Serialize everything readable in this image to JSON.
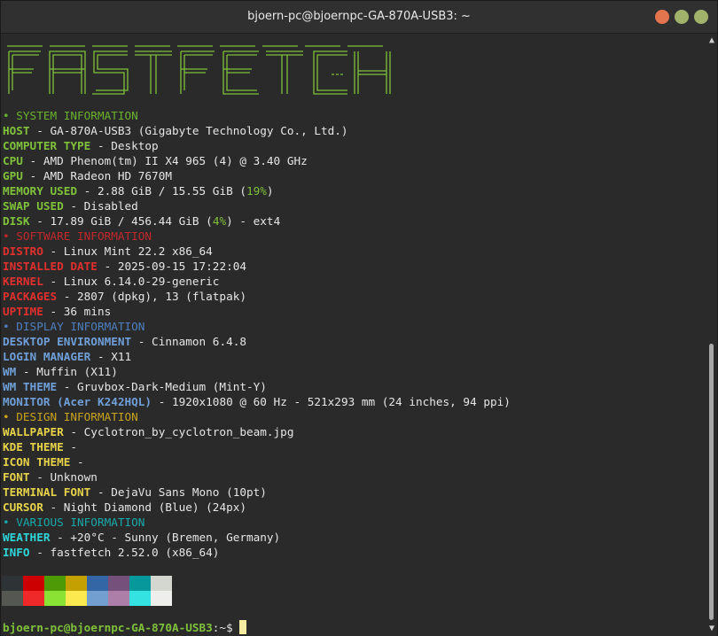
{
  "window": {
    "title": "bjoern-pc@bjoernpc-GA-870A-USB3: ~",
    "controls": [
      "close",
      "minimize",
      "maximize"
    ]
  },
  "logo_text": "FASTFETCH",
  "sections": {
    "system": {
      "header": "• SYSTEM INFORMATION",
      "host": {
        "key": "HOST",
        "value": " - GA-870A-USB3 (Gigabyte Technology Co., Ltd.)"
      },
      "computer_type": {
        "key": "COMPUTER TYPE",
        "value": " - Desktop"
      },
      "cpu": {
        "key": "CPU",
        "value": " - AMD Phenom(tm) II X4 965 (4) @ 3.40 GHz"
      },
      "gpu": {
        "key": "GPU",
        "value": " - AMD Radeon HD 7670M"
      },
      "memory": {
        "key": "MEMORY USED",
        "pre": " - 2.88 GiB / 15.55 GiB (",
        "pct": "19%",
        "post": ")"
      },
      "swap": {
        "key": "SWAP USED",
        "value": " - Disabled"
      },
      "disk": {
        "key": "DISK",
        "pre": " - 17.89 GiB / 456.44 GiB (",
        "pct": "4%",
        "post": ") - ext4"
      }
    },
    "software": {
      "header": "• SOFTWARE INFORMATION",
      "distro": {
        "key": "DISTRO",
        "value": " - Linux Mint 22.2 x86_64"
      },
      "installed": {
        "key": "INSTALLED DATE",
        "value": " - 2025-09-15 17:22:04"
      },
      "kernel": {
        "key": "KERNEL",
        "value": " - Linux 6.14.0-29-generic"
      },
      "packages": {
        "key": "PACKAGES",
        "value": " - 2807 (dpkg), 13 (flatpak)"
      },
      "uptime": {
        "key": "UPTIME",
        "value": " - 36 mins"
      }
    },
    "display": {
      "header": "• DISPLAY INFORMATION",
      "de": {
        "key": "DESKTOP ENVIRONMENT",
        "value": " - Cinnamon 6.4.8"
      },
      "login": {
        "key": "LOGIN MANAGER",
        "value": " - X11"
      },
      "wm": {
        "key": "WM",
        "value": " - Muffin (X11)"
      },
      "wm_theme": {
        "key": "WM THEME",
        "value": " - Gruvbox-Dark-Medium (Mint-Y)"
      },
      "monitor": {
        "key": "MONITOR (Acer K242HQL)",
        "value": " - 1920x1080 @ 60 Hz - 521x293 mm (24 inches, 94 ppi)"
      }
    },
    "design": {
      "header": "• DESIGN INFORMATION",
      "wallpaper": {
        "key": "WALLPAPER",
        "value": " - Cyclotron_by_cyclotron_beam.jpg"
      },
      "kde_theme": {
        "key": "KDE THEME",
        "value": " -"
      },
      "icon_theme": {
        "key": "ICON THEME",
        "value": " -"
      },
      "font": {
        "key": "FONT",
        "value": " - Unknown"
      },
      "terminal_font": {
        "key": "TERMINAL FONT",
        "value": " - DejaVu Sans Mono (10pt)"
      },
      "cursor": {
        "key": "CURSOR",
        "value": " - Night Diamond (Blue) (24px)"
      }
    },
    "various": {
      "header": "• VARIOUS INFORMATION",
      "weather": {
        "key": "WEATHER",
        "value": " - +20°C - Sunny (Bremen, Germany)"
      },
      "info": {
        "key": "INFO",
        "value": " - fastfetch 2.52.0 (x86_64)"
      }
    }
  },
  "palette": {
    "top": [
      "#2e3436",
      "#cc0000",
      "#4e9a06",
      "#c4a000",
      "#3465a4",
      "#75507b",
      "#06989a",
      "#d3d7cf"
    ],
    "bottom": [
      "#555753",
      "#ef2929",
      "#8ae234",
      "#fce94f",
      "#729fcf",
      "#ad7fa8",
      "#34e2e2",
      "#eeeeec"
    ]
  },
  "prompt": {
    "user_host": "bjoern-pc@bjoernpc-GA-870A-USB3",
    "path_sep": ":~$ "
  }
}
